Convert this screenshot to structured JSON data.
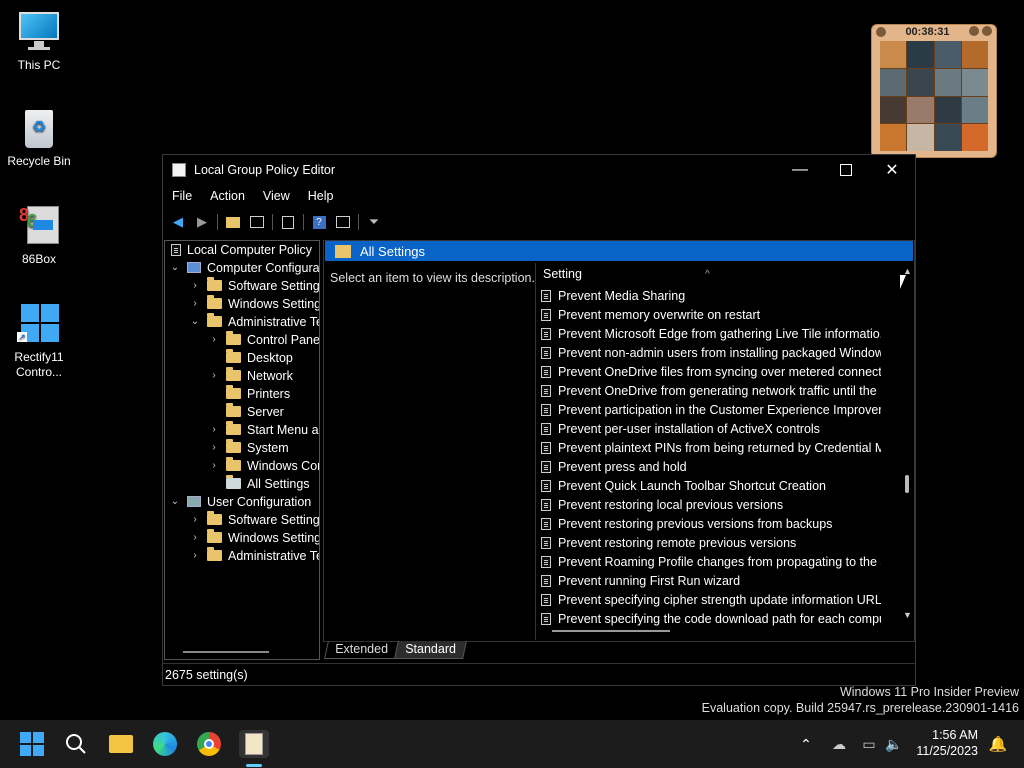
{
  "desktop": {
    "icons": [
      {
        "label": "This PC"
      },
      {
        "label": "Recycle Bin"
      },
      {
        "label": "86Box"
      },
      {
        "label": "Rectify11 Contro..."
      }
    ]
  },
  "puzzle": {
    "timer": "00:38:31"
  },
  "window": {
    "title": "Local Group Policy Editor",
    "menu": [
      "File",
      "Action",
      "View",
      "Help"
    ],
    "tree": {
      "root": "Local Computer Policy",
      "items": [
        "Computer Configura",
        "Software Settings",
        "Windows Setting",
        "Administrative Te",
        "Control Panel",
        "Desktop",
        "Network",
        "Printers",
        "Server",
        "Start Menu ar",
        "System",
        "Windows Cor",
        "All Settings",
        "User Configuration",
        "Software Settings",
        "Windows Setting",
        "Administrative Te"
      ]
    },
    "pane": {
      "header": "All Settings",
      "description": "Select an item to view its description.",
      "column": "Setting",
      "rows": [
        "Prevent Media Sharing",
        "Prevent memory overwrite on restart",
        "Prevent Microsoft Edge from gathering Live Tile informatio...",
        "Prevent non-admin users from installing packaged Window...",
        "Prevent OneDrive files from syncing over metered connecti...",
        "Prevent OneDrive from generating network traffic until the ...",
        "Prevent participation in the Customer Experience Improvem...",
        "Prevent per-user installation of ActiveX controls",
        "Prevent plaintext PINs from being returned by Credential M...",
        "Prevent press and hold",
        "Prevent Quick Launch Toolbar Shortcut Creation",
        "Prevent restoring local previous versions",
        "Prevent restoring previous versions from backups",
        "Prevent restoring remote previous versions",
        "Prevent Roaming Profile changes from propagating to the s...",
        "Prevent running First Run wizard",
        "Prevent specifying cipher strength update information URLs",
        "Prevent specifying the code download path for each compu..."
      ]
    },
    "tabs": [
      "Extended",
      "Standard"
    ],
    "status": "2675 setting(s)"
  },
  "watermark": {
    "line1": "Windows 11 Pro Insider Preview",
    "line2": "Evaluation copy. Build 25947.rs_prerelease.230901-1416"
  },
  "taskbar": {
    "time": "1:56 AM",
    "date": "11/25/2023"
  }
}
